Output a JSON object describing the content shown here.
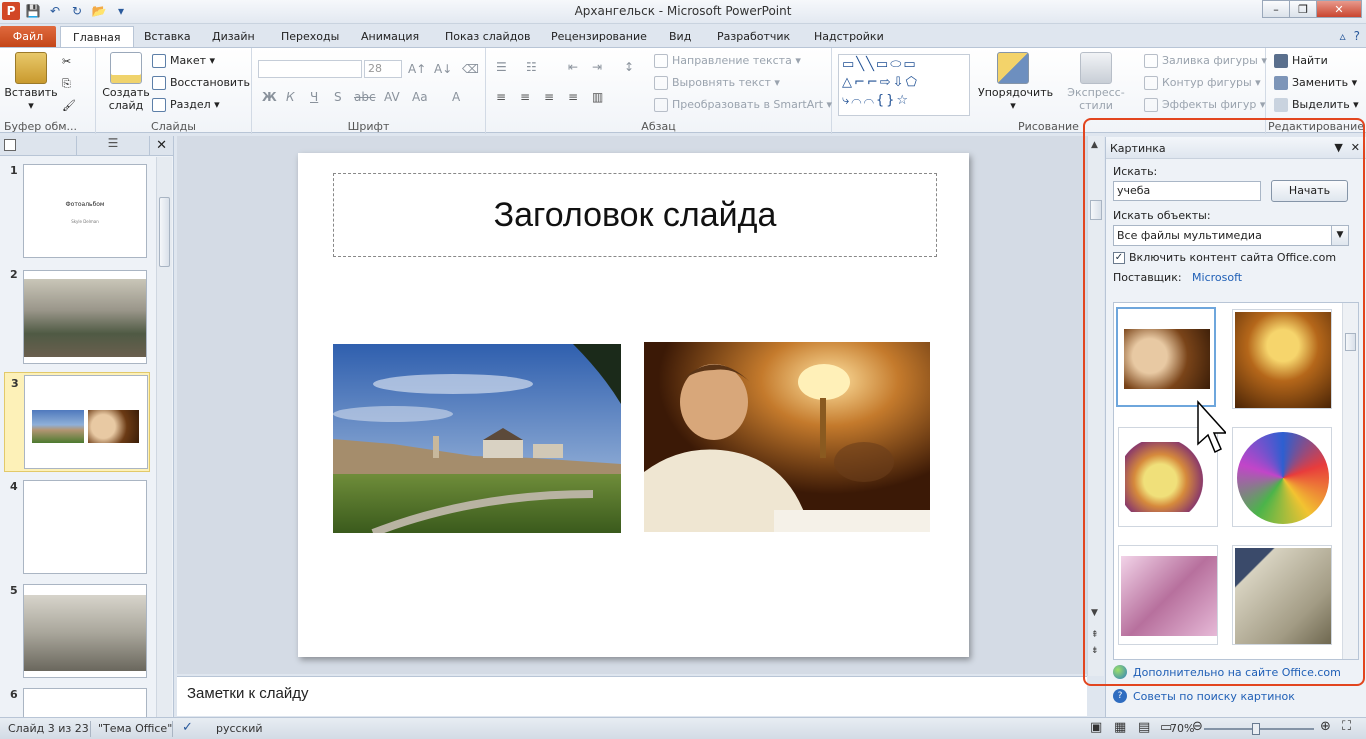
{
  "window": {
    "title": "Архангельск - Microsoft PowerPoint",
    "logo": "P"
  },
  "tabs": {
    "file": "Файл",
    "items": [
      "Главная",
      "Вставка",
      "Дизайн",
      "Переходы",
      "Анимация",
      "Показ слайдов",
      "Рецензирование",
      "Вид",
      "Разработчик",
      "Надстройки"
    ]
  },
  "ribbon": {
    "clipboard": {
      "label": "Буфер обм...",
      "paste": "Вставить"
    },
    "slides": {
      "label": "Слайды",
      "new_slide": "Создать слайд",
      "layout": "Макет",
      "reset": "Восстановить",
      "section": "Раздел"
    },
    "font": {
      "label": "Шрифт",
      "size": "28",
      "bold": "Ж",
      "italic": "К",
      "underline": "Ч",
      "shadow": "S",
      "strike": "abc",
      "spacing": "AV",
      "case": "Aa",
      "color": "A"
    },
    "paragraph": {
      "label": "Абзац",
      "text_direction": "Направление текста",
      "align_text": "Выровнять текст",
      "smartart": "Преобразовать в SmartArt"
    },
    "drawing": {
      "label": "Рисование",
      "arrange": "Упорядочить",
      "quick_styles": "Экспресс-стили",
      "fill": "Заливка фигуры",
      "outline": "Контур фигуры",
      "effects": "Эффекты фигур"
    },
    "editing": {
      "label": "Редактирование",
      "find": "Найти",
      "replace": "Заменить",
      "select": "Выделить"
    }
  },
  "slides_panel": {
    "thumbnails": [
      {
        "num": "1",
        "title": "Фотоальбом",
        "subtitle": "Skyle Delman"
      },
      {
        "num": "2"
      },
      {
        "num": "3"
      },
      {
        "num": "4"
      },
      {
        "num": "5"
      },
      {
        "num": "6"
      }
    ]
  },
  "slide": {
    "title": "Заголовок слайда"
  },
  "notes": {
    "placeholder": "Заметки к слайду"
  },
  "clipart": {
    "pane_title": "Картинка",
    "search_label": "Искать:",
    "search_value": "учеба",
    "go_button": "Начать",
    "search_in_label": "Искать объекты:",
    "media_type": "Все файлы мультимедиа",
    "include_office": "Включить контент сайта Office.com",
    "provider_label": "Поставщик:",
    "provider": "Microsoft",
    "more_link": "Дополнительно на сайте Office.com",
    "tips_link": "Советы по поиску картинок"
  },
  "status": {
    "slide_of": "Слайд 3 из 23",
    "theme": "\"Тема Office\"",
    "language": "русский",
    "zoom": "70%"
  },
  "colors": {
    "accent": "#2a5a9c",
    "file_tab": "#c24416",
    "highlight_frame": "#e2451f"
  }
}
